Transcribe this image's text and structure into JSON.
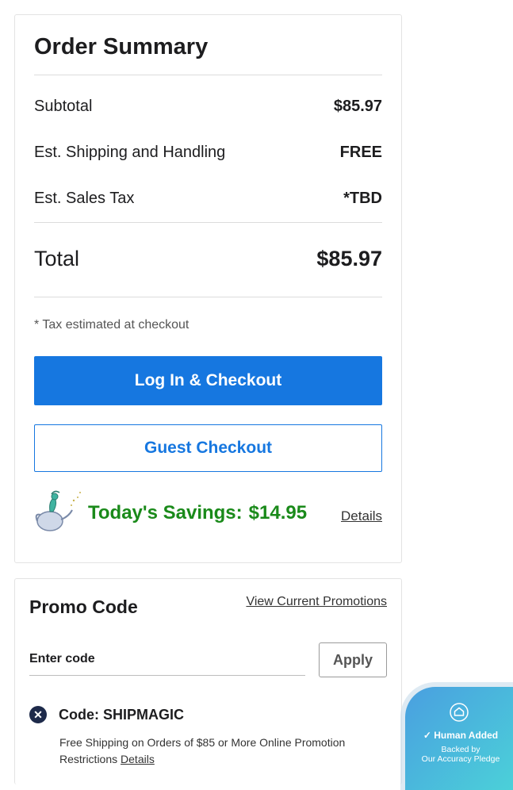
{
  "order_summary": {
    "title": "Order Summary",
    "subtotal_label": "Subtotal",
    "subtotal_value": "$85.97",
    "shipping_label": "Est. Shipping and Handling",
    "shipping_value": "FREE",
    "tax_label": "Est. Sales Tax",
    "tax_value": "*TBD",
    "total_label": "Total",
    "total_value": "$85.97",
    "tax_note": "* Tax estimated at checkout",
    "login_checkout_label": "Log In & Checkout",
    "guest_checkout_label": "Guest Checkout",
    "savings_label": "Today's Savings:",
    "savings_value": "$14.95",
    "savings_details_label": "Details",
    "savings_icon": "genie-lamp-icon"
  },
  "promo": {
    "title": "Promo Code",
    "view_promotions_label": "View Current Promotions",
    "input_placeholder": "Enter code",
    "input_value": "",
    "apply_label": "Apply",
    "applied_code_label": "Code: SHIPMAGIC",
    "applied_code_desc": "Free Shipping on Orders of $85 or More Online Promotion Restrictions",
    "applied_code_details_label": "Details",
    "remove_icon": "remove-x-icon"
  },
  "pledge_badge": {
    "main_label": "Human Added",
    "sub_line1": "Backed by",
    "sub_line2": "Our Accuracy Pledge",
    "icon": "house-icon",
    "check_icon": "check-circle-icon"
  },
  "colors": {
    "primary_blue": "#1677e0",
    "savings_green": "#1a8a1a",
    "remove_icon_bg": "#1d2a4a",
    "badge_gradient_start": "#4a9fe0",
    "badge_gradient_end": "#4bd3d8"
  }
}
